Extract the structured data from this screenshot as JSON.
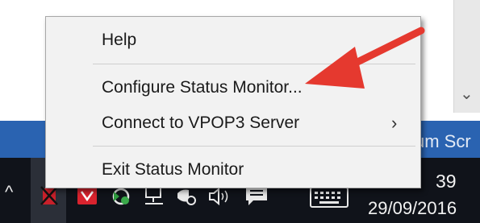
{
  "menu": {
    "items": [
      {
        "label": "Help"
      },
      {
        "label": "Configure Status Monitor..."
      },
      {
        "label": "Connect to VPOP3 Server",
        "submenu_indicator": "›"
      },
      {
        "label": "Exit Status Monitor"
      }
    ]
  },
  "background": {
    "blue_strip_text": "um  Scr"
  },
  "taskbar": {
    "overflow_icon": "^",
    "clock_time": "39",
    "clock_date": "29/09/2016"
  },
  "colors": {
    "arrow": "#e5392f",
    "taskbar": "#10131a",
    "blue_strip": "#2a63b1",
    "menu_bg": "#f2f2f2"
  },
  "icons": [
    "status-monitor-icon",
    "red-app-icon",
    "network-sync-icon",
    "network-icon",
    "security-icon",
    "volume-icon",
    "action-center-icon",
    "keyboard-icon"
  ]
}
